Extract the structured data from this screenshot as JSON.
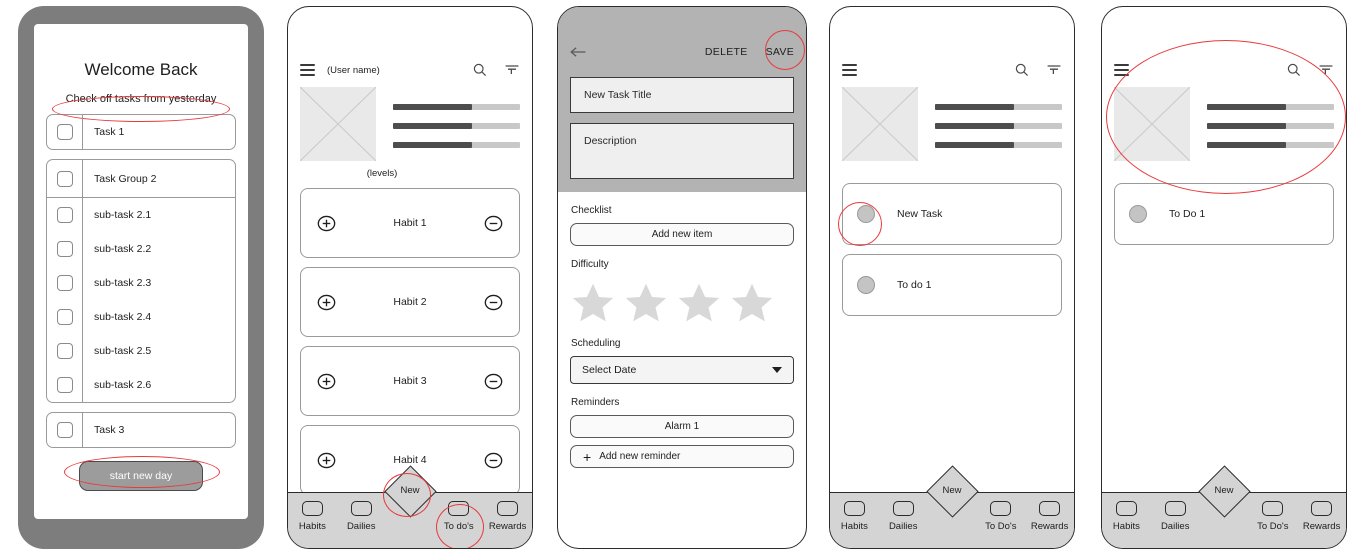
{
  "panels": {
    "welcome": {
      "title": "Welcome Back",
      "subtitle": "Check off tasks from yesterday",
      "start_button": "start new day",
      "tasks": [
        {
          "label": "Task 1"
        }
      ],
      "group": {
        "head": "Task Group 2",
        "subtasks": [
          "sub-task 2.1",
          "sub-task 2.2",
          "sub-task 2.3",
          "sub-task 2.4",
          "sub-task 2.5",
          "sub-task 2.6"
        ]
      },
      "task3": "Task 3"
    },
    "habits": {
      "username": "(User name)",
      "levels_caption": "(levels)",
      "level_bars": [
        62,
        62,
        62
      ],
      "items": [
        "Habit 1",
        "Habit 2",
        "Habit 3",
        "Habit 4"
      ],
      "nav": {
        "new": "New",
        "items": [
          "Habits",
          "Dailies",
          "To do's",
          "Rewards"
        ]
      }
    },
    "editor": {
      "delete": "DELETE",
      "save": "SAVE",
      "title_field": "New Task Title",
      "description_field": "Description",
      "checklist_label": "Checklist",
      "add_item": "Add new item",
      "difficulty_label": "Difficulty",
      "stars": 4,
      "scheduling_label": "Scheduling",
      "date_value": "Select Date",
      "reminders_label": "Reminders",
      "alarm": "Alarm 1",
      "add_reminder": "Add new reminder"
    },
    "todo_a": {
      "level_bars": [
        62,
        62,
        62
      ],
      "items": [
        "New Task",
        "To do 1"
      ],
      "nav": {
        "new": "New",
        "items": [
          "Habits",
          "Dailies",
          "To Do's",
          "Rewards"
        ]
      }
    },
    "todo_b": {
      "level_bars": [
        62,
        62,
        62
      ],
      "items": [
        "To Do 1"
      ],
      "nav": {
        "new": "New",
        "items": [
          "Habits",
          "Dailies",
          "To Do's",
          "Rewards"
        ]
      }
    }
  },
  "colors": {
    "annotation": "#e8393c",
    "bar_fill": "#4d4d4d",
    "bar_track": "#c8c8c8",
    "nav_bg": "#d4d4d4",
    "header_bg": "#b3b3b3"
  }
}
